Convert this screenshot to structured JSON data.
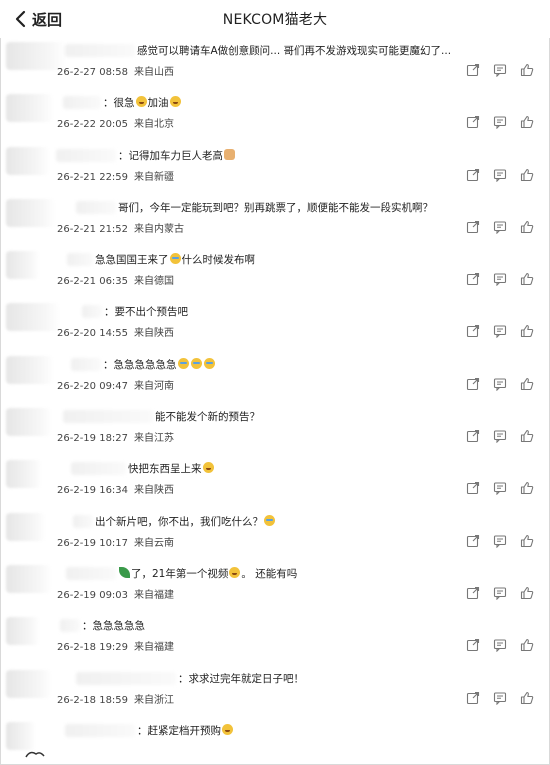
{
  "header": {
    "back_label": "返回",
    "title": "NEKCOM猫老大"
  },
  "comments": [
    {
      "text": "感觉可以聘请车A做创意顾问... 哥们再不发游戏现实可能更魔幻了...",
      "emoji": "",
      "date": "26-2-27 08:58",
      "location": "来自山西"
    },
    {
      "text": "：很急",
      "emoji": "laugh",
      "text2": "加油",
      "emoji2": "laugh",
      "date": "26-2-22 20:05",
      "location": "来自北京"
    },
    {
      "text": "：记得加车力巨人老高",
      "emoji": "dog",
      "date": "26-2-21 22:59",
      "location": "来自新疆"
    },
    {
      "text": "哥们，今年一定能玩到吧？别再跳票了，顺便能不能发一段实机啊？",
      "emoji": "",
      "date": "26-2-21 21:52",
      "location": "来自内蒙古"
    },
    {
      "text": "急急国国王来了",
      "emoji": "crying",
      "text2": "什么时候发布啊",
      "date": "26-2-21 06:35",
      "location": "来自德国"
    },
    {
      "text": "：要不出个预告吧",
      "emoji": "",
      "date": "26-2-20 14:55",
      "location": "来自陕西"
    },
    {
      "text": "：急急急急急急",
      "emoji": "crying",
      "emoji_count": 3,
      "date": "26-2-20 09:47",
      "location": "来自河南"
    },
    {
      "text": "能不能发个新的预告？",
      "emoji": "",
      "date": "26-2-19 18:27",
      "location": "来自江苏"
    },
    {
      "text": "快把东西呈上来",
      "emoji": "laugh",
      "date": "26-2-19 16:34",
      "location": "来自陕西"
    },
    {
      "text": "出个新片吧，你不出，我们吃什么？",
      "emoji": "crying",
      "date": "26-2-19 10:17",
      "location": "来自云南"
    },
    {
      "text": "了，21年第一个视频",
      "emoji_before": "leaf",
      "emoji": "laugh",
      "text2": "。 还能有吗",
      "date": "26-2-19 09:03",
      "location": "来自福建"
    },
    {
      "text": "：急急急急急",
      "emoji": "",
      "date": "26-2-18 19:29",
      "location": "来自福建"
    },
    {
      "text": "：求求过完年就定日子吧！",
      "emoji": "",
      "date": "26-2-18 18:59",
      "location": "来自浙江"
    },
    {
      "text": "：赶紧定档开预购",
      "emoji": "laugh",
      "date": "",
      "location": ""
    }
  ],
  "actions": {
    "share_icon": "share-icon",
    "comment_icon": "comment-icon",
    "like_icon": "like-icon"
  }
}
